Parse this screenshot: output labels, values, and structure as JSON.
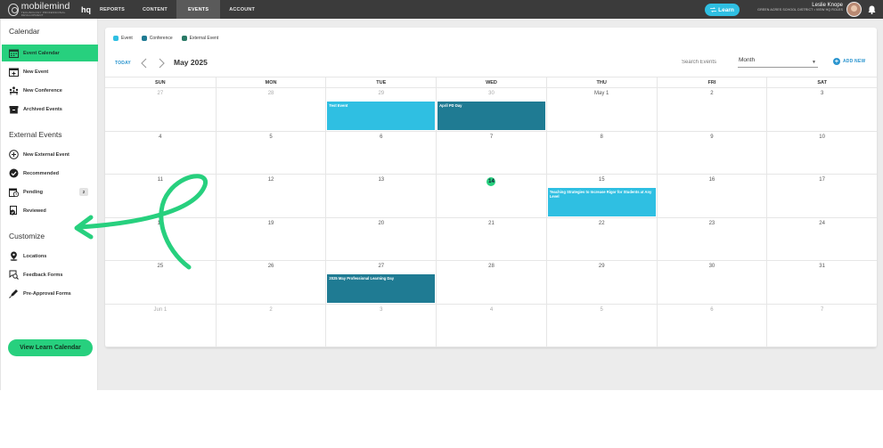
{
  "topbar": {
    "brand_name": "mobilemind",
    "brand_tagline": "TECHNOLOGY PROFESSIONAL DEVELOPMENT",
    "brand_hq": "hq",
    "nav": [
      {
        "label": "REPORTS",
        "active": false
      },
      {
        "label": "CONTENT",
        "active": false
      },
      {
        "label": "EVENTS",
        "active": true
      },
      {
        "label": "ACCOUNT",
        "active": false
      }
    ],
    "learn_button": "Learn",
    "user_name": "Leslie Knope",
    "user_meta": "GREEN ACRES SCHOOL DISTRICT • VIEW HQ ROLES"
  },
  "sidebar": {
    "calendar_heading": "Calendar",
    "calendar_items": [
      {
        "label": "Event Calendar",
        "icon": "calendar-icon",
        "active": true
      },
      {
        "label": "New Event",
        "icon": "calendar-plus-icon",
        "active": false
      },
      {
        "label": "New Conference",
        "icon": "conference-icon",
        "active": false
      },
      {
        "label": "Archived Events",
        "icon": "archive-icon",
        "active": false
      }
    ],
    "external_heading": "External Events",
    "external_items": [
      {
        "label": "New External Event",
        "icon": "plus-circle-icon"
      },
      {
        "label": "Recommended",
        "icon": "check-circle-icon"
      },
      {
        "label": "Pending",
        "icon": "pending-icon",
        "badge": "2"
      },
      {
        "label": "Reviewed",
        "icon": "reviewed-icon"
      }
    ],
    "customize_heading": "Customize",
    "customize_items": [
      {
        "label": "Locations",
        "icon": "location-pin-icon"
      },
      {
        "label": "Feedback Forms",
        "icon": "feedback-search-icon"
      },
      {
        "label": "Pre-Approval Forms",
        "icon": "pen-icon"
      }
    ],
    "learn_calendar_button": "View Learn Calendar"
  },
  "legend": [
    {
      "label": "Event",
      "color": "#2fbfe2"
    },
    {
      "label": "Conference",
      "color": "#1f7b93"
    },
    {
      "label": "External Event",
      "color": "#2a7a66"
    }
  ],
  "toolbar": {
    "today": "TODAY",
    "month": "May 2025",
    "search_placeholder": "Search Events",
    "view": "Month",
    "add_new": "ADD NEW"
  },
  "calendar": {
    "days_of_week": [
      "SUN",
      "MON",
      "TUE",
      "WED",
      "THU",
      "FRI",
      "SAT"
    ],
    "weeks": [
      [
        {
          "n": "27",
          "other": true
        },
        {
          "n": "28",
          "other": true
        },
        {
          "n": "29",
          "other": true
        },
        {
          "n": "30",
          "other": true
        },
        {
          "n": "May 1",
          "other": false
        },
        {
          "n": "2",
          "other": false
        },
        {
          "n": "3",
          "other": false
        }
      ],
      [
        {
          "n": "4"
        },
        {
          "n": "5"
        },
        {
          "n": "6"
        },
        {
          "n": "7"
        },
        {
          "n": "8"
        },
        {
          "n": "9"
        },
        {
          "n": "10"
        }
      ],
      [
        {
          "n": "11"
        },
        {
          "n": "12"
        },
        {
          "n": "13"
        },
        {
          "n": "14",
          "today": true
        },
        {
          "n": "15"
        },
        {
          "n": "16"
        },
        {
          "n": "17"
        }
      ],
      [
        {
          "n": "18"
        },
        {
          "n": "19"
        },
        {
          "n": "20"
        },
        {
          "n": "21"
        },
        {
          "n": "22"
        },
        {
          "n": "23"
        },
        {
          "n": "24"
        }
      ],
      [
        {
          "n": "25"
        },
        {
          "n": "26"
        },
        {
          "n": "27"
        },
        {
          "n": "28"
        },
        {
          "n": "29"
        },
        {
          "n": "30"
        },
        {
          "n": "31"
        }
      ],
      [
        {
          "n": "Jun 1",
          "other": true
        },
        {
          "n": "2",
          "other": true
        },
        {
          "n": "3",
          "other": true
        },
        {
          "n": "4",
          "other": true
        },
        {
          "n": "5",
          "other": true
        },
        {
          "n": "6",
          "other": true
        },
        {
          "n": "7",
          "other": true
        }
      ]
    ],
    "events": [
      {
        "title": "Test Event",
        "week": 0,
        "day": 2,
        "color": "#2fbfe2"
      },
      {
        "title": "April PD Day",
        "week": 0,
        "day": 3,
        "color": "#1f7b93"
      },
      {
        "title": "Teaching Strategies to Increase Rigor for Students at Any Level",
        "week": 2,
        "day": 4,
        "color": "#2fbfe2"
      },
      {
        "title": "2025 May Professional Learning Day",
        "week": 4,
        "day": 2,
        "color": "#1f7b93"
      }
    ]
  },
  "annotation": {
    "arrow_color": "#27d07e"
  }
}
